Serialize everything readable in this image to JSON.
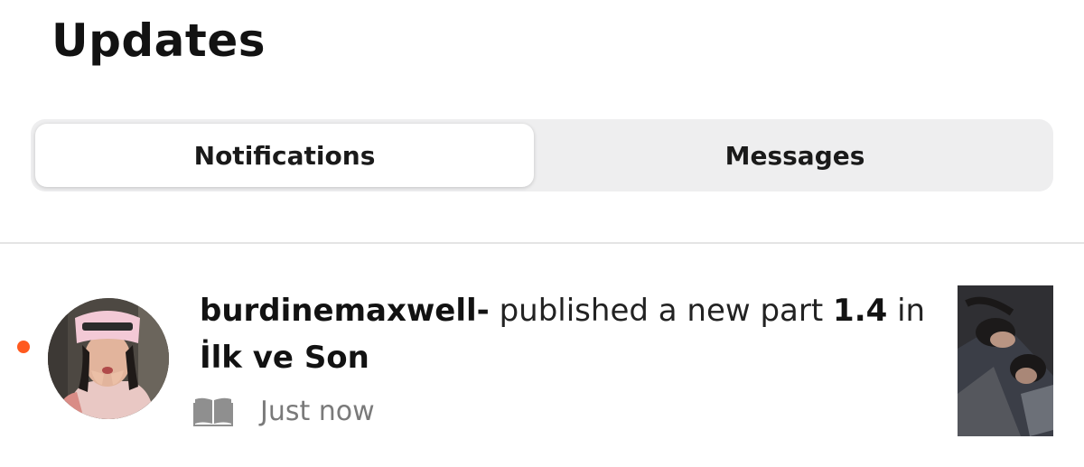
{
  "header": {
    "title": "Updates"
  },
  "tabs": [
    {
      "label": "Notifications",
      "active": true
    },
    {
      "label": "Messages",
      "active": false
    }
  ],
  "notification": {
    "username": "burdinemaxwell-",
    "action": "published a new part",
    "part": "1.4",
    "preposition": "in",
    "story_title": "İlk ve Son",
    "timestamp": "Just now",
    "unread_color": "#ff5a1f",
    "type_icon": "book-icon",
    "avatar": "user-avatar",
    "thumbnail": "story-cover"
  }
}
